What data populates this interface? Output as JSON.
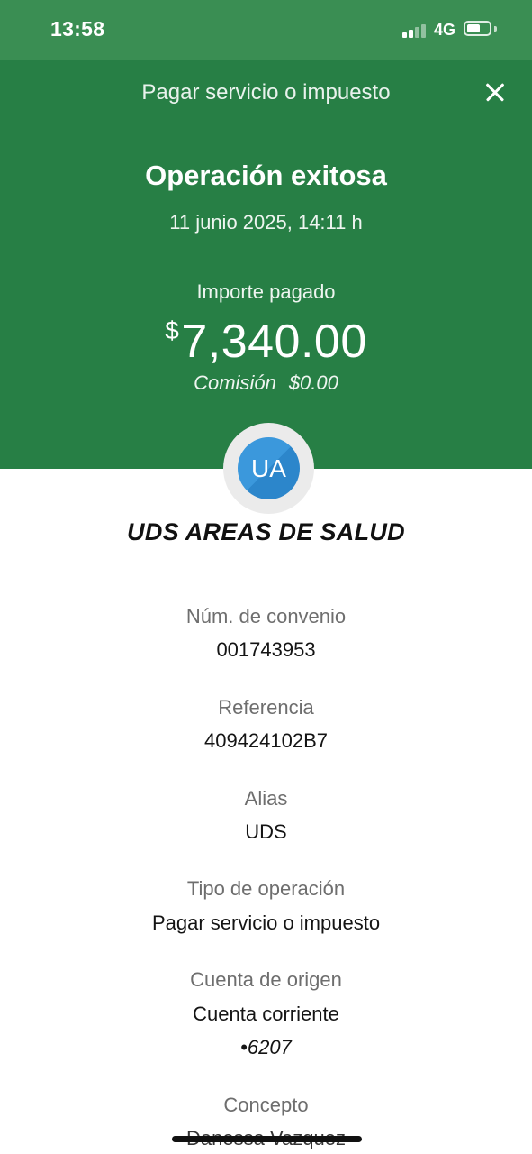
{
  "status_bar": {
    "time": "13:58",
    "network": "4G",
    "battery_level": 0.62
  },
  "header": {
    "title": "Pagar servicio o impuesto"
  },
  "confirmation": {
    "title": "Operación exitosa",
    "datetime": "11 junio 2025, 14:11 h",
    "amount_label": "Importe pagado",
    "currency_symbol": "$",
    "amount": "7,340.00",
    "commission_label": "Comisión",
    "commission_value": "$0.00"
  },
  "merchant": {
    "initials": "UA",
    "name": "UDS AREAS DE SALUD"
  },
  "details": {
    "agreement_label": "Núm. de convenio",
    "agreement_value": "001743953",
    "reference_label": "Referencia",
    "reference_value": "409424102B7",
    "alias_label": "Alias",
    "alias_value": "UDS",
    "operation_type_label": "Tipo de operación",
    "operation_type_value": "Pagar servicio o impuesto",
    "source_account_label": "Cuenta de origen",
    "source_account_value": "Cuenta corriente",
    "source_account_number": "•6207",
    "concept_label": "Concepto",
    "concept_value": "Danessa Vazquez"
  },
  "colors": {
    "status_bar": "#3a8e53",
    "hero_green": "#277f45",
    "avatar_blue": "#3b98dc"
  }
}
